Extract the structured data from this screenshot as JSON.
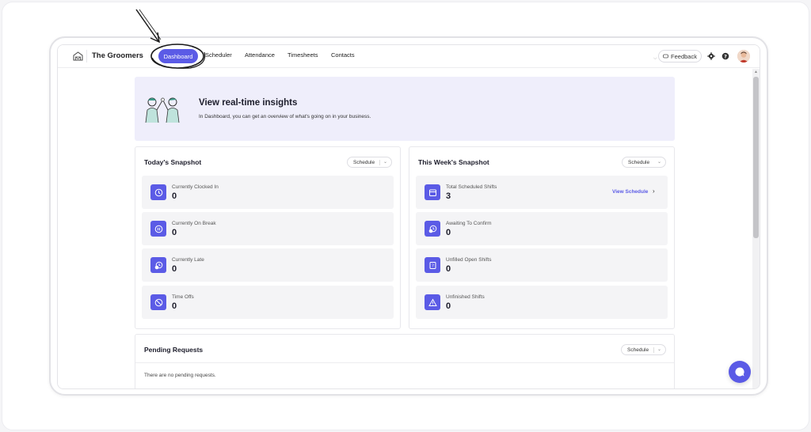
{
  "header": {
    "brand": "The Groomers",
    "nav": [
      {
        "label": "Dashboard",
        "active": true
      },
      {
        "label": "Scheduler"
      },
      {
        "label": "Attendance"
      },
      {
        "label": "Timesheets"
      },
      {
        "label": "Contacts"
      }
    ],
    "feedback_label": "Feedback",
    "icons": [
      "logo-icon",
      "feedback-icon",
      "gear-icon",
      "help-icon",
      "avatar"
    ]
  },
  "banner": {
    "title": "View real-time insights",
    "subtitle": "In Dashboard, you can get an overview of what's going on in your business."
  },
  "today": {
    "title": "Today's Snapshot",
    "dropdown": "Schedule",
    "items": [
      {
        "label": "Currently Clocked In",
        "value": "0",
        "icon": "clock-icon"
      },
      {
        "label": "Currently On Break",
        "value": "0",
        "icon": "pause-icon"
      },
      {
        "label": "Currently Late",
        "value": "0",
        "icon": "late-clock-icon"
      },
      {
        "label": "Time Offs",
        "value": "0",
        "icon": "block-icon"
      }
    ]
  },
  "week": {
    "title": "This Week's Snapshot",
    "dropdown": "Schedule",
    "view_link": "View Schedule",
    "items": [
      {
        "label": "Total Scheduled Shifts",
        "value": "3",
        "icon": "calendar-icon"
      },
      {
        "label": "Awaiting To Confirm",
        "value": "0",
        "icon": "awaiting-icon"
      },
      {
        "label": "Unfilled Open Shifts",
        "value": "0",
        "icon": "open-shift-icon"
      },
      {
        "label": "Unfinished Shifts",
        "value": "0",
        "icon": "warning-icon"
      }
    ]
  },
  "pending": {
    "title": "Pending Requests",
    "dropdown": "Schedule",
    "empty_text": "There are no pending requests."
  },
  "colors": {
    "accent": "#5b5be6",
    "banner_bg": "#efeefb",
    "card_bg": "#f4f4f6"
  }
}
